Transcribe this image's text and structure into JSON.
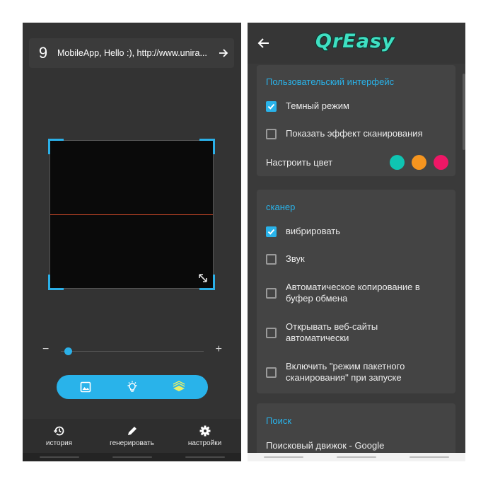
{
  "scanner_screen": {
    "history": {
      "count": "9",
      "text": "MobileApp, Hello :), http://www.unira..."
    },
    "zoom": {
      "minus": "−",
      "plus": "+",
      "level": 0.05
    },
    "nav": [
      {
        "label": "история",
        "icon": "history-icon"
      },
      {
        "label": "генерировать",
        "icon": "pencil-icon"
      },
      {
        "label": "настройки",
        "icon": "gear-icon"
      }
    ],
    "actions": [
      "gallery-icon",
      "flashlight-icon",
      "batch-scan-icon"
    ],
    "colors": {
      "accent": "#29b3ea",
      "scan_line": "#d24a2a",
      "batch_icon": "#e8f06a"
    }
  },
  "settings_screen": {
    "logo": "QrEasy",
    "sections": {
      "ui": {
        "title": "Пользовательский интерфейс",
        "dark_mode": {
          "label": "Темный режим",
          "checked": true
        },
        "scan_effect": {
          "label": "Показать эффект сканирования",
          "checked": false
        },
        "color": {
          "label": "Настроить цвет",
          "swatches": [
            "#0fc4b2",
            "#f5951f",
            "#ee1766"
          ]
        }
      },
      "scanner": {
        "title": "сканер",
        "vibrate": {
          "label": "вибрировать",
          "checked": true
        },
        "sound": {
          "label": "Звук",
          "checked": false
        },
        "auto_copy": {
          "label": "Автоматическое копирование в буфер обмена",
          "checked": false
        },
        "open_sites": {
          "label": "Открывать веб-сайты автоматически",
          "checked": false
        },
        "batch_mode": {
          "label": "Включить \"режим пакетного сканирования\" при запуске",
          "checked": false
        }
      },
      "search": {
        "title": "Поиск",
        "engine": {
          "label": "Поисковый движок - Google"
        }
      }
    }
  }
}
